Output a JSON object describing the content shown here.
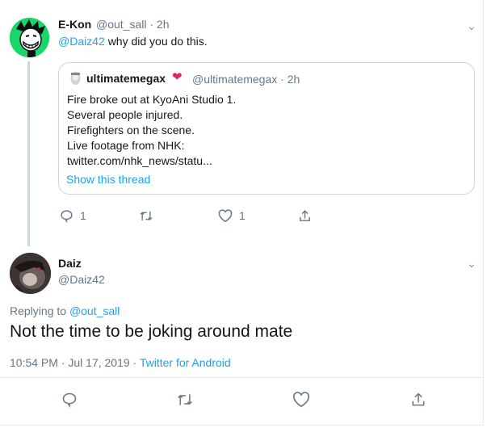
{
  "first_tweet": {
    "name": "E-Kon",
    "handle": "@out_sall",
    "time": "2h",
    "mention": "@Daiz42",
    "text": "why did you do this.",
    "quote": {
      "name": "ultimatemegax",
      "handle": "@ultimatemegax",
      "time": "2h",
      "lines": [
        "Fire broke out at KyoAni Studio 1.",
        "Several people injured.",
        "Firefighters on the scene.",
        "Live footage from NHK:",
        "twitter.com/nhk_news/statu..."
      ],
      "show_thread": "Show this thread"
    },
    "actions": {
      "reply_count": "1",
      "like_count": "1"
    }
  },
  "second_tweet": {
    "name": "Daiz",
    "handle": "@Daiz42",
    "replying_prefix": "Replying to",
    "replying_to": "@out_sall",
    "text": "Not the time to be joking around mate",
    "timestamp": "10:54 PM · Jul 17, 2019 ·",
    "source": "Twitter for Android"
  },
  "colors": {
    "link": "#1da1f2",
    "muted": "#657786",
    "heart": "#e0245e",
    "avatar_bg": "#1ad66a"
  },
  "icons": [
    "reply-icon",
    "retweet-icon",
    "like-icon",
    "share-icon",
    "chevron-down-icon",
    "heart-emoji-icon"
  ]
}
